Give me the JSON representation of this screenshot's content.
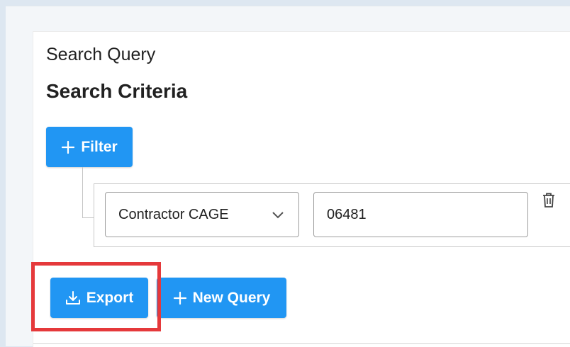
{
  "header": {
    "query_title": "Search Query",
    "criteria_title": "Search Criteria"
  },
  "filter_button": {
    "label": "Filter",
    "icon": "plus-icon"
  },
  "filter_row": {
    "field_select": {
      "selected": "Contractor CAGE",
      "icon": "chevron-down-icon"
    },
    "value_input": {
      "value": "06481"
    },
    "delete_icon": "trash-icon"
  },
  "actions": {
    "export_label": "Export",
    "export_icon": "download-icon",
    "new_query_label": "New Query",
    "new_query_icon": "plus-icon"
  },
  "colors": {
    "primary": "#2196f3",
    "highlight": "#e5393b"
  }
}
